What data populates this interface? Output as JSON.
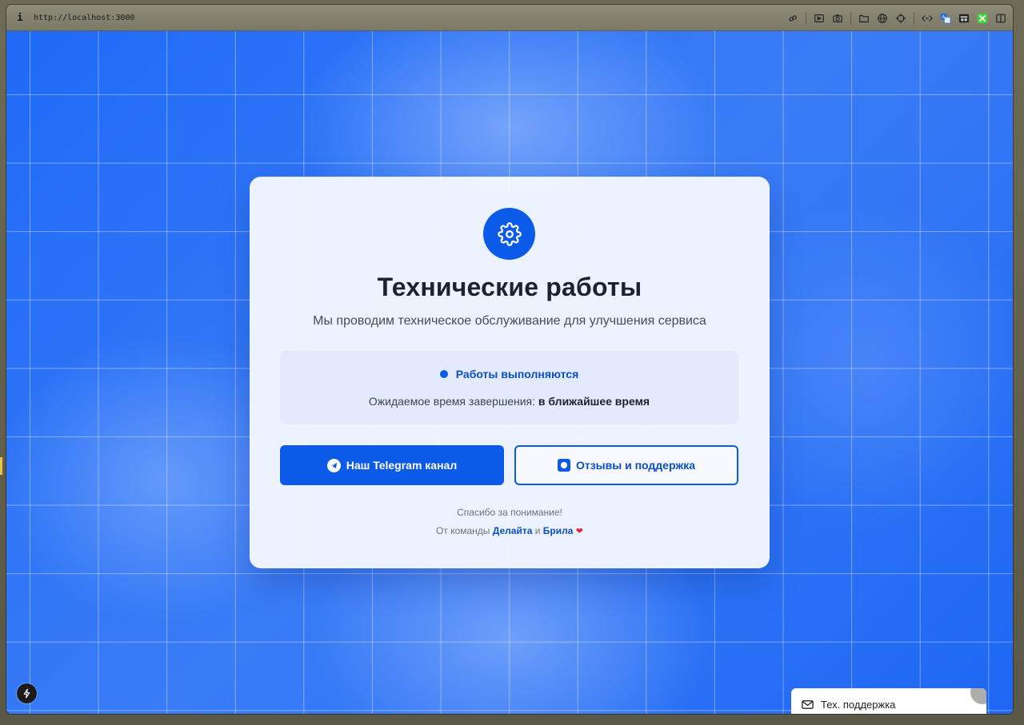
{
  "browser": {
    "info_glyph": "i",
    "url": "http://localhost:3000"
  },
  "card": {
    "title": "Технические работы",
    "subtitle": "Мы проводим техническое обслуживание для улучшения сервиса",
    "status": {
      "label": "Работы выполняются",
      "eta_prefix": "Ожидаемое время завершения:",
      "eta_value": "в ближайшее время"
    },
    "buttons": {
      "telegram": "Наш Telegram канал",
      "support": "Отзывы и поддержка"
    },
    "footer": {
      "thanks": "Спасибо за понимание!",
      "team_prefix": "От команды",
      "team_a": "Делайта",
      "and": "и",
      "team_b": "Брила",
      "heart": "❤"
    }
  },
  "support_widget": {
    "label": "Тех. поддержка"
  },
  "colors": {
    "accent": "#0b5be8",
    "background": "#1f6af7",
    "card": "#f3f7fe"
  }
}
